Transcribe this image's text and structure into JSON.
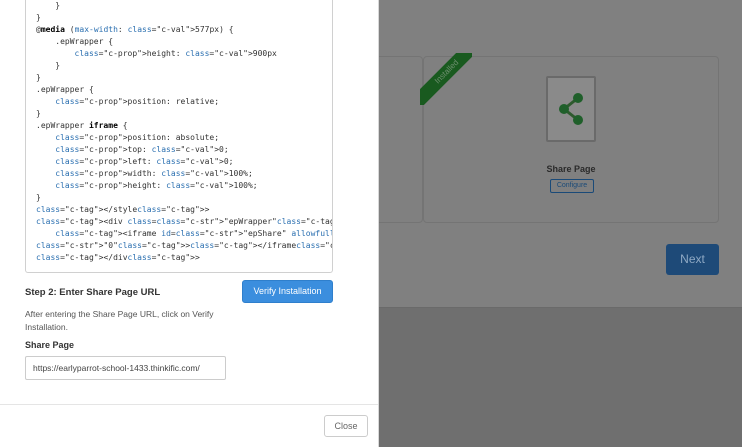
{
  "background": {
    "ribbon_label": "Installed",
    "share_card_title": "Share Page",
    "configure_label": "Configure",
    "next_label": "Next",
    "share_icon": "share-icon"
  },
  "modal": {
    "code_lines": [
      "    }",
      "}",
      "@media (max-width: 577px) {",
      "    .epWrapper {",
      "        height: 900px",
      "    }",
      "}",
      ".epWrapper {",
      "    position: relative;",
      "}",
      ".epWrapper iframe {",
      "    position: absolute;",
      "    top: 0;",
      "    left: 0;",
      "    width: 100%;",
      "    height: 100%;",
      "}",
      "</style>",
      "<div class=\"epWrapper\">",
      "    <iframe id=\"epShare\" allowfullscreen frameborder=",
      "\"0\"></iframe>",
      "</div>"
    ],
    "step_title": "Step 2: Enter Share Page URL",
    "step_description": "After entering the Share Page URL, click on Verify Installation.",
    "verify_label": "Verify Installation",
    "share_page_label": "Share Page",
    "share_page_value": "https://earlyparrot-school-1433.thinkific.com/",
    "close_label": "Close"
  },
  "colors": {
    "primary_blue": "#3b8ede",
    "installed_green": "#2e8b3a"
  }
}
